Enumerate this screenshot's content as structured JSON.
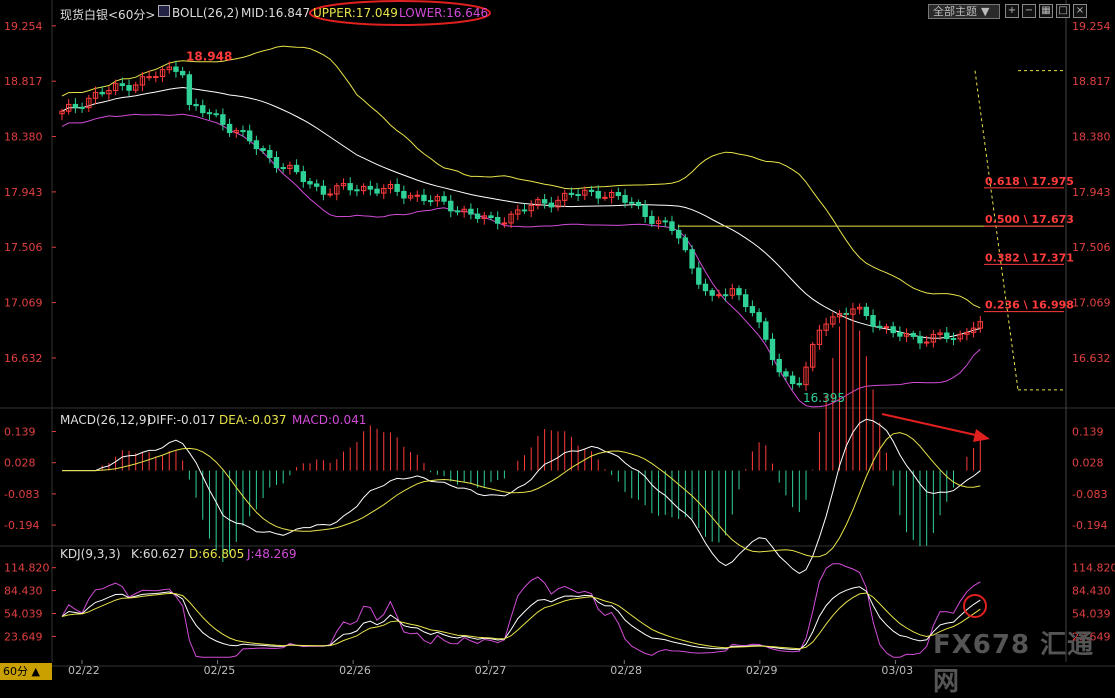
{
  "main_legend": {
    "symbol": "现货白银<60分>",
    "boll": "BOLL(26,2)",
    "mid": "MID:16.847",
    "upper": "UPPER:17.049",
    "lower": "LOWER:16.646"
  },
  "macd_legend": {
    "name": "MACD(26,12,9)",
    "diff": "DIFF:-0.017",
    "dea": "DEA:-0.037",
    "macd": "MACD:0.041"
  },
  "kdj_legend": {
    "name": "KDJ(9,3,3)",
    "k": "K:60.627",
    "d": "D:66.805",
    "j": "J:48.269"
  },
  "toolbar": {
    "theme_label": "全部主题",
    "icons": [
      "add-icon",
      "minus-icon",
      "grid-icon",
      "window-icon",
      "close-icon"
    ]
  },
  "period_label": "60分 ▲",
  "watermark": "FX678 汇通网",
  "colors": {
    "up": "#ff3b3b",
    "down": "#2fd196",
    "mid": "#ffffff",
    "upper": "#e8e34a",
    "lower": "#d24cd8",
    "dea": "#e8e34a",
    "j": "#d24cd8",
    "highlight": "#e0201e"
  },
  "chart_data": [
    {
      "type": "candlestick",
      "title": "现货白银 60分",
      "y_ticks": [
        "19.254",
        "18.817",
        "18.380",
        "17.943",
        "17.506",
        "17.069",
        "16.632"
      ],
      "ylim": [
        16.3,
        19.3
      ],
      "x_ticks": [
        "02/22",
        "02/25",
        "02/26",
        "02/27",
        "02/28",
        "02/29",
        "03/03"
      ],
      "annotations": {
        "high_label": "18.948",
        "low_label": "16.395"
      },
      "fibonacci": {
        "levels": [
          {
            "label": "0.618",
            "value": "17.975"
          },
          {
            "label": "0.500",
            "value": "17.673"
          },
          {
            "label": "0.382",
            "value": "17.371"
          },
          {
            "label": "0.236",
            "value": "16.998"
          }
        ]
      }
    },
    {
      "type": "bar",
      "title": "MACD(26,12,9)",
      "y_ticks": [
        "0.139",
        "0.028",
        "-0.083",
        "-0.194"
      ],
      "ylim": [
        -0.24,
        0.18
      ]
    },
    {
      "type": "line",
      "title": "KDJ(9,3,3)",
      "y_ticks": [
        "114.820",
        "84.430",
        "54.039",
        "23.649"
      ],
      "ylim": [
        -5,
        125
      ]
    }
  ]
}
